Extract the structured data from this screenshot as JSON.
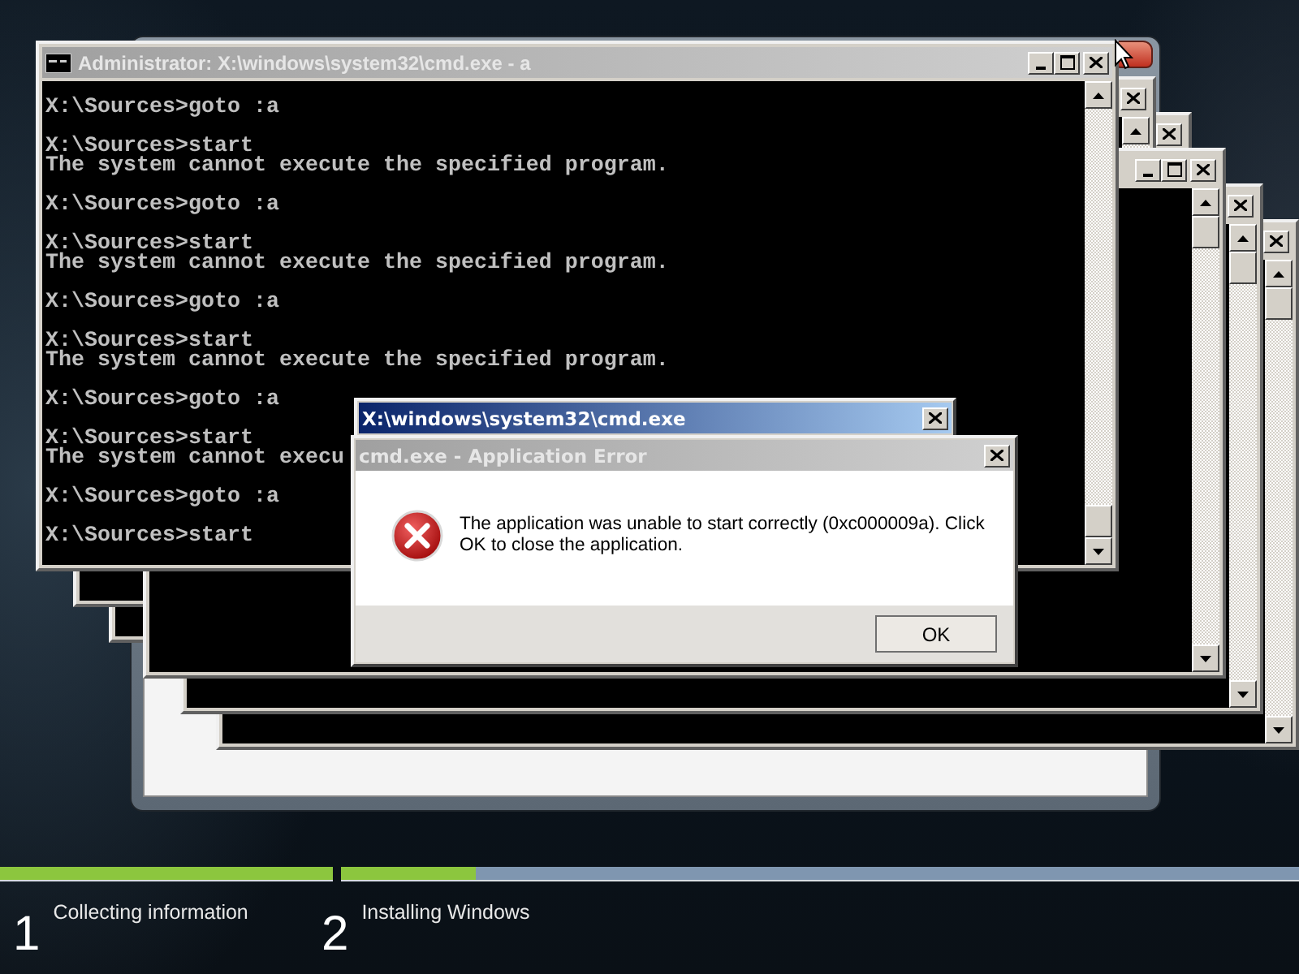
{
  "console": {
    "title": "Administrator: X:\\windows\\system32\\cmd.exe - a",
    "active": false,
    "blocks": [
      [
        "X:\\Sources>goto :a"
      ],
      [
        "X:\\Sources>start",
        "The system cannot execute the specified program."
      ],
      [
        "X:\\Sources>goto :a"
      ],
      [
        "X:\\Sources>start",
        "The system cannot execute the specified program."
      ],
      [
        "X:\\Sources>goto :a"
      ],
      [
        "X:\\Sources>start",
        "The system cannot execute the specified program."
      ],
      [
        "X:\\Sources>goto :a"
      ],
      [
        "X:\\Sources>start",
        "The system cannot execu"
      ],
      [
        "X:\\Sources>goto :a"
      ],
      [
        "X:\\Sources>start"
      ]
    ]
  },
  "dialogs": [
    {
      "title": "X:\\windows\\system32\\cmd.exe",
      "active": true
    },
    {
      "title": "cmd.exe - Application Error",
      "active": false,
      "message": "The application was unable to start correctly (0xc000009a). Click OK to close the application.",
      "button": "OK"
    }
  ],
  "progress": [
    {
      "level": 1
    },
    {
      "level": 0.14
    }
  ],
  "steps": [
    {
      "number": "1",
      "label": "Collecting information"
    },
    {
      "number": "2",
      "label": "Installing Windows"
    }
  ]
}
